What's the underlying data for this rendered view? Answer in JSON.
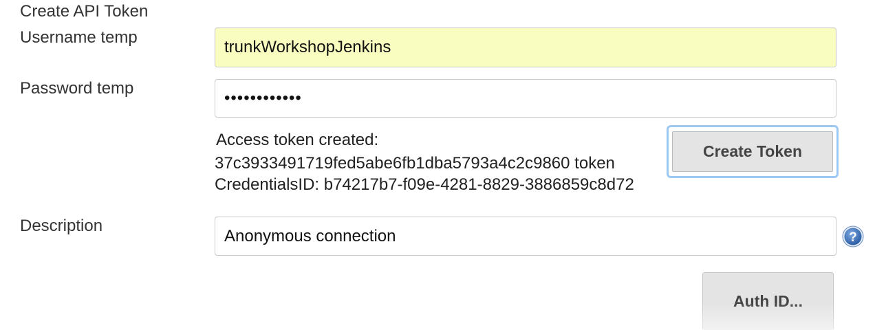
{
  "section": {
    "title": "Create API Token"
  },
  "username": {
    "label": "Username temp",
    "value": "trunkWorkshopJenkins"
  },
  "password": {
    "label": "Password temp",
    "value": "••••••••••••"
  },
  "token_result": {
    "heading": "Access token created:",
    "token_line": "37c3933491719fed5abe6fb1dba5793a4c2c9860 token",
    "credentials_line": "CredentialsID: b74217b7-f09e-4281-8829-3886859c8d72"
  },
  "create_token_button": {
    "label": "Create Token"
  },
  "description": {
    "label": "Description",
    "value": "Anonymous connection"
  },
  "help": {
    "icon": "help-icon"
  },
  "auth_id_button": {
    "label": "Auth ID..."
  },
  "colors": {
    "autofill_background": "#fafdc0",
    "focus_ring": "#9cc8f4",
    "help_icon": "#3a6fb5"
  }
}
